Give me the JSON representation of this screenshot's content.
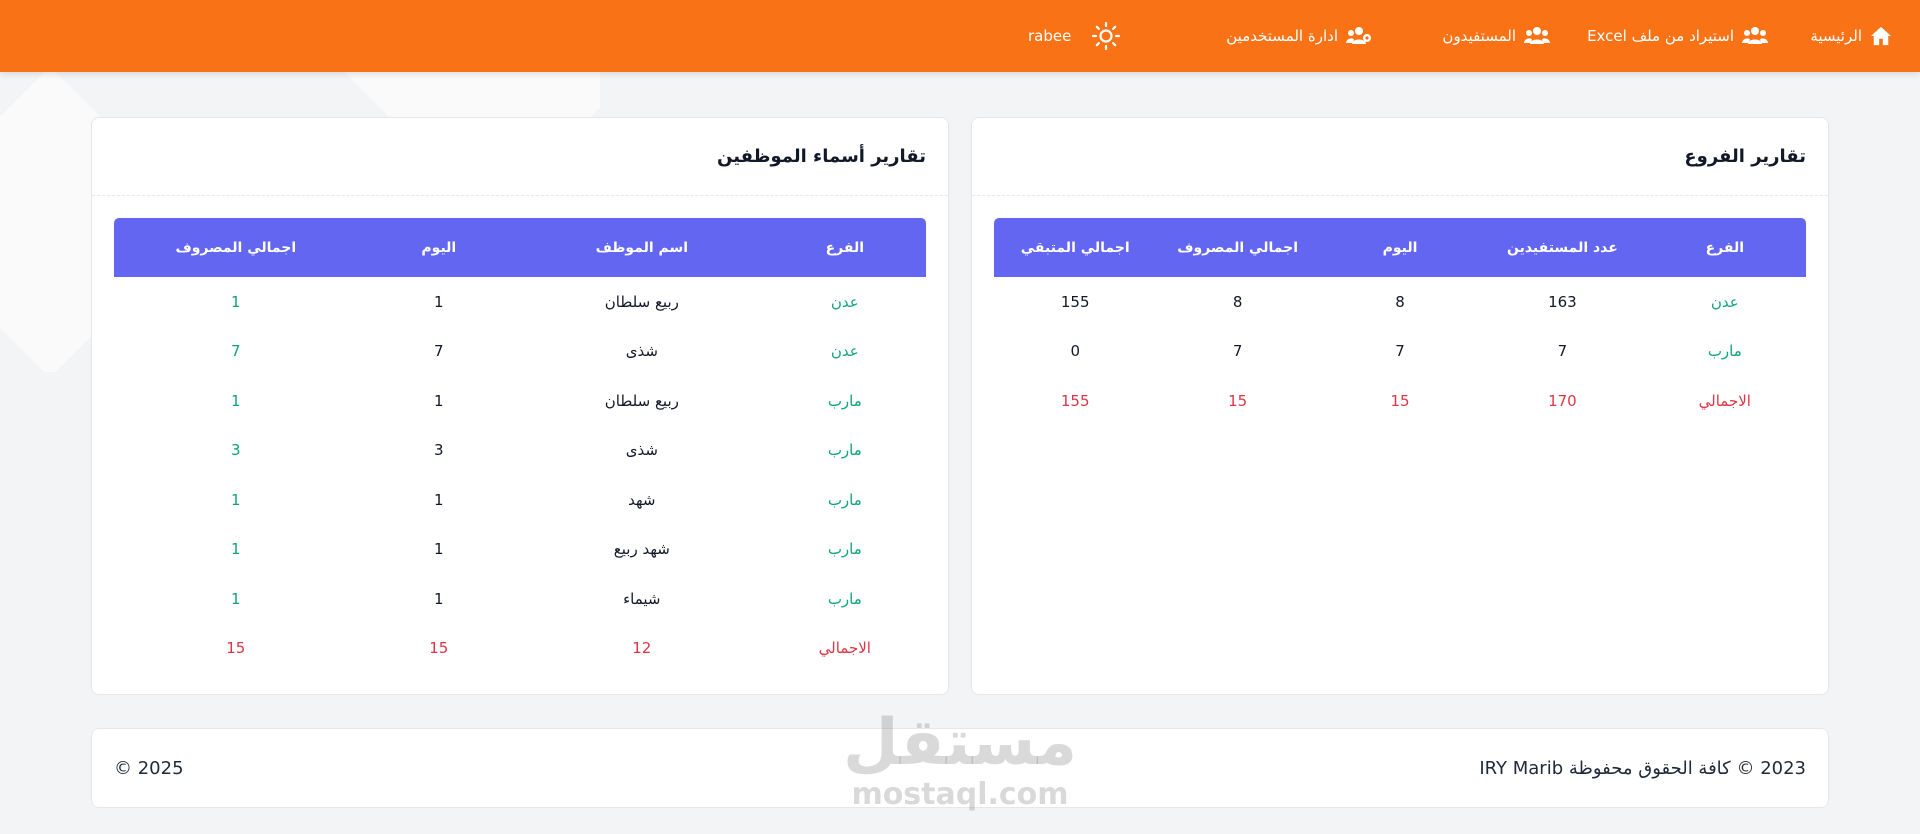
{
  "navbar": {
    "home_label": "الرئيسية",
    "import_label": "استيراد من ملف Excel",
    "beneficiaries_label": "المستفيدون",
    "users_label": "ادارة المستخدمين",
    "username": "rabee",
    "color": "#f97316"
  },
  "branches_report": {
    "title": "تقارير الفروع",
    "columns": [
      "الفرع",
      "عدد المستفيدين",
      "اليوم",
      "اجمالي المصروف",
      "اجمالي المتبقي"
    ],
    "rows": [
      [
        "عدن",
        "163",
        "8",
        "8",
        "155"
      ],
      [
        "مارب",
        "7",
        "7",
        "7",
        "0"
      ]
    ],
    "total": [
      "الاجمالي",
      "170",
      "15",
      "15",
      "155"
    ]
  },
  "employees_report": {
    "title": "تقارير أسماء الموظفين",
    "columns": [
      "الفرع",
      "اسم الموظف",
      "اليوم",
      "اجمالي المصروف"
    ],
    "rows": [
      [
        "عدن",
        "ربيع سلطان",
        "1",
        "1"
      ],
      [
        "عدن",
        "شذى",
        "7",
        "7"
      ],
      [
        "مارب",
        "ربيع سلطان",
        "1",
        "1"
      ],
      [
        "مارب",
        "شذى",
        "3",
        "3"
      ],
      [
        "مارب",
        "شهد",
        "1",
        "1"
      ],
      [
        "مارب",
        "شهد ربيع",
        "1",
        "1"
      ],
      [
        "مارب",
        "شيماء",
        "1",
        "1"
      ]
    ],
    "total": [
      "الاجمالي",
      "12",
      "15",
      "15"
    ]
  },
  "footer": {
    "copyright": "2023 © كافة الحقوق محفوظة IRY Marib",
    "year": "© 2025"
  },
  "watermark": {
    "arabic": "مستقل",
    "latin": "mostaql.com"
  },
  "colors": {
    "header": "#6366f1",
    "green": "#10a37f",
    "red": "#dc3545"
  }
}
